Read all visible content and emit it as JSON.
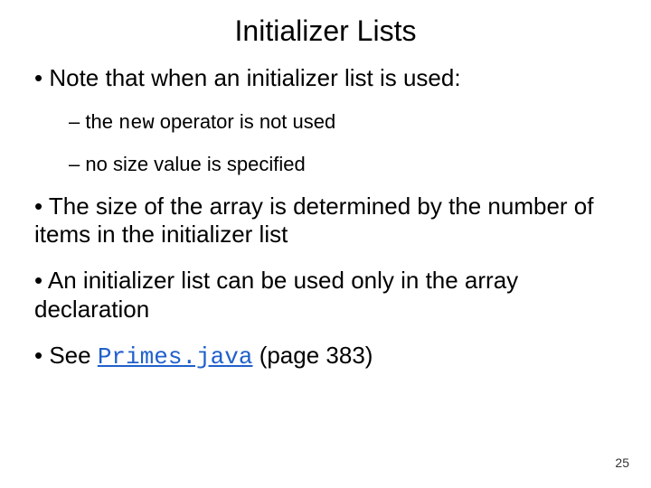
{
  "title": "Initializer Lists",
  "b1": "Note that when an initializer list is used:",
  "s1_pre": "the ",
  "s1_code": "new",
  "s1_post": " operator is not used",
  "s2": "no size value is specified",
  "b2": "The size of the array is determined by the number of items in the initializer list",
  "b3": "An initializer list can be used only in the array declaration",
  "b4_pre": "See ",
  "b4_link": "Primes.java",
  "b4_post": " (page 383)",
  "page_number": "25"
}
